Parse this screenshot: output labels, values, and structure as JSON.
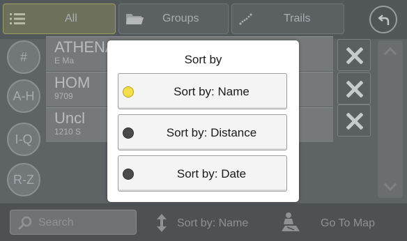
{
  "tabs": {
    "all": {
      "label": "All",
      "icon": "list-icon",
      "selected": true
    },
    "groups": {
      "label": "Groups",
      "icon": "folder-icon"
    },
    "trails": {
      "label": "Trails",
      "icon": "trail-dots-icon"
    },
    "back_icon": "back-arrow-icon"
  },
  "index": [
    "#",
    "A-H",
    "I-Q",
    "R-Z"
  ],
  "list": {
    "rows": [
      {
        "name": "ATHENA, OREGON",
        "address": "E Ma"
      },
      {
        "name": "HOM",
        "address": "9709"
      },
      {
        "name": "Uncl",
        "address": "1210 S"
      }
    ],
    "delete_icon": "close-x-icon"
  },
  "bottom": {
    "search_placeholder": "Search",
    "sort_label": "Sort by: Name",
    "gomap_label": "Go To Map"
  },
  "modal": {
    "title": "Sort by",
    "options": [
      {
        "label": "Sort by: Name",
        "selected": true
      },
      {
        "label": "Sort by: Distance",
        "selected": false
      },
      {
        "label": "Sort by: Date",
        "selected": false
      }
    ]
  },
  "colors": {
    "selected_dot": "#f3df4c",
    "unselected_dot": "#4a4a4a",
    "overlay_background": "#5e6366"
  }
}
